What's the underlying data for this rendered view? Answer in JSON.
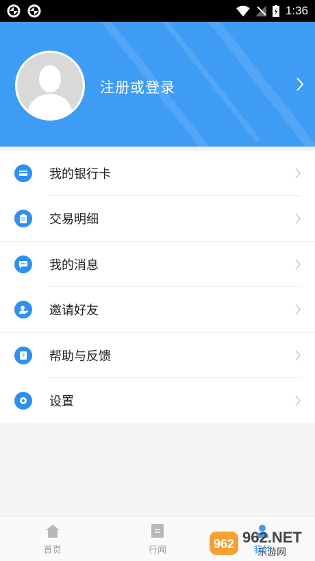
{
  "status_bar": {
    "time": "1:36"
  },
  "header": {
    "login_label": "注册或登录"
  },
  "menu": {
    "groups": [
      [
        {
          "label": "我的银行卡",
          "icon": "bank-card-icon"
        },
        {
          "label": "交易明细",
          "icon": "clipboard-icon"
        }
      ],
      [
        {
          "label": "我的消息",
          "icon": "message-icon"
        },
        {
          "label": "邀请好友",
          "icon": "user-add-icon"
        }
      ],
      [
        {
          "label": "帮助与反馈",
          "icon": "help-icon"
        },
        {
          "label": "设置",
          "icon": "gear-icon"
        }
      ]
    ]
  },
  "tabbar": {
    "tabs": [
      {
        "label": "首页",
        "icon": "home-icon"
      },
      {
        "label": "行闻",
        "icon": "news-icon"
      },
      {
        "label": "我的",
        "icon": "profile-icon"
      }
    ]
  },
  "watermark": {
    "brand": "962.NET",
    "sub": "乐游网"
  },
  "colors": {
    "primary": "#3f9cf4",
    "icon_bg": "#2f8ff2",
    "background": "#f4f4f4"
  }
}
